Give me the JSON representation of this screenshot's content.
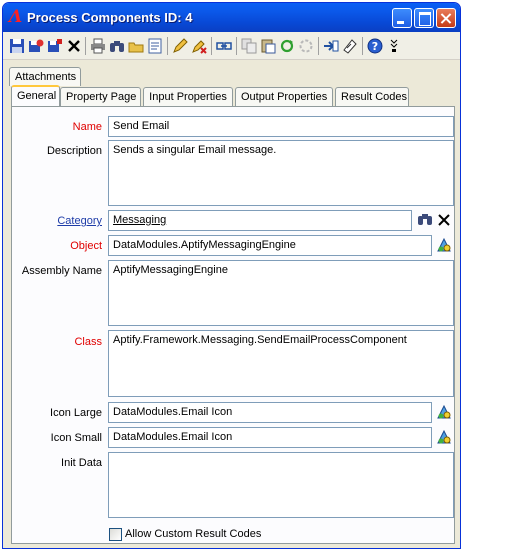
{
  "window": {
    "title": "Process Components ID: 4",
    "logo_glyph": "Λ"
  },
  "tabs_row1": [
    {
      "label": "Attachments"
    }
  ],
  "tabs_row2": [
    {
      "label": "General",
      "active": true
    },
    {
      "label": "Property Page"
    },
    {
      "label": "Input Properties"
    },
    {
      "label": "Output Properties"
    },
    {
      "label": "Result Codes"
    }
  ],
  "form": {
    "name": {
      "label": "Name",
      "value": "Send Email"
    },
    "description": {
      "label": "Description",
      "value": "Sends a singular Email message."
    },
    "category": {
      "label": "Category",
      "value": "Messaging"
    },
    "object": {
      "label": "Object",
      "value": "DataModules.AptifyMessagingEngine"
    },
    "assembly_name": {
      "label": "Assembly Name",
      "value": "AptifyMessagingEngine"
    },
    "class": {
      "label": "Class",
      "value": "Aptify.Framework.Messaging.SendEmailProcessComponent"
    },
    "icon_large": {
      "label": "Icon Large",
      "value": "DataModules.Email Icon"
    },
    "icon_small": {
      "label": "Icon Small",
      "value": "DataModules.Email Icon"
    },
    "init_data": {
      "label": "Init Data",
      "value": ""
    },
    "allow_custom_result_codes": {
      "label": "Allow Custom Result Codes",
      "checked": false
    }
  },
  "colors": {
    "required_label": "#e00000",
    "link_label": "#1e3ca8",
    "title_bar": "#0a5ff5"
  }
}
